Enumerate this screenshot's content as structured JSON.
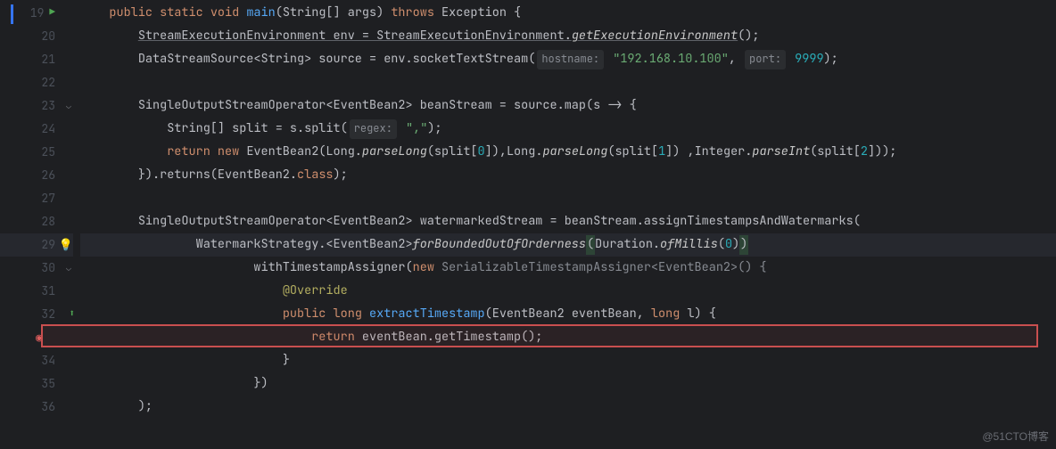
{
  "gutter": {
    "lines": [
      {
        "num": "19",
        "run": true,
        "blueBar": true
      },
      {
        "num": "20"
      },
      {
        "num": "21"
      },
      {
        "num": "22"
      },
      {
        "num": "23",
        "fold": true
      },
      {
        "num": "24"
      },
      {
        "num": "25"
      },
      {
        "num": "26"
      },
      {
        "num": "27"
      },
      {
        "num": "28"
      },
      {
        "num": "29",
        "bulb": true
      },
      {
        "num": "30",
        "fold": true
      },
      {
        "num": "31"
      },
      {
        "num": "32",
        "diff": true
      },
      {
        "num": "",
        "breakpoint": true
      },
      {
        "num": "34"
      },
      {
        "num": "35"
      },
      {
        "num": "36"
      }
    ]
  },
  "code": {
    "l19": {
      "indent": "    ",
      "public": "public ",
      "static": "static ",
      "void": "void ",
      "main": "main",
      "args": "(String[] args) ",
      "throws": "throws ",
      "exc": "Exception {"
    },
    "l20": {
      "indent": "        ",
      "t1": "StreamExecutionEnvironment env = StreamExecutionEnvironment.",
      "m": "getExecutionEnvironment",
      "t2": "();"
    },
    "l21": {
      "indent": "        ",
      "t1": "DataStreamSource<String> source = env.socketTextStream(",
      "h1": "hostname:",
      "s1": " \"192.168.10.100\"",
      "c": ", ",
      "h2": "port:",
      "n": " 9999",
      "t2": ");"
    },
    "l23": {
      "indent": "        ",
      "t1": "SingleOutputStreamOperator<EventBean2> beanStream = source.map(s -> {"
    },
    "l24": {
      "indent": "            ",
      "t1": "String[] split = s.split(",
      "h": "regex:",
      "s": " \",\"",
      "t2": ");"
    },
    "l25": {
      "indent": "            ",
      "ret": "return ",
      "new": "new ",
      "cls": "EventBean2(Long.",
      "m1": "parseLong",
      "t1": "(split[",
      "n0": "0",
      "t2": "]),Long.",
      "m2": "parseLong",
      "t3": "(split[",
      "n1": "1",
      "t4": "]) ,Integer.",
      "m3": "parseInt",
      "t5": "(split[",
      "n2": "2",
      "t6": "]));"
    },
    "l26": {
      "indent": "        ",
      "t1": "}).returns(EventBean2.",
      "cls": "class",
      "t2": ");"
    },
    "l28": {
      "indent": "        ",
      "t1": "SingleOutputStreamOperator<EventBean2> watermarkedStream = beanStream.assignTimestampsAndWatermarks("
    },
    "l29": {
      "indent": "                ",
      "t1": "WatermarkStrategy.<EventBean2>",
      "m": "forBoundedOutOfOrderness",
      "p1": "(",
      "d": "Duration.",
      "m2": "ofMillis",
      "p2": "(",
      "n": "0",
      "p3": ")",
      ")": ")"
    },
    "l30": {
      "indent": "                        ",
      ".": ".",
      "m": "withTimestampAssigner",
      "p": "(",
      "new": "new ",
      "cls": "SerializableTimestampAssigner<EventBean2>() {"
    },
    "l31": {
      "indent": "                            ",
      "ann": "@Override"
    },
    "l32": {
      "indent": "                            ",
      "pub": "public ",
      "long": "long ",
      "m": "extractTimestamp",
      "p": "(EventBean2 eventBean, ",
      "long2": "long ",
      "l": "l) {"
    },
    "l33": {
      "indent": "                                ",
      "ret": "return ",
      "t": "eventBean.getTimestamp();"
    },
    "l34": {
      "indent": "                            ",
      "t": "}"
    },
    "l35": {
      "indent": "                        ",
      "t": "})"
    },
    "l36": {
      "indent": "        ",
      "t": ");"
    }
  },
  "watermark": "@51CTO博客"
}
